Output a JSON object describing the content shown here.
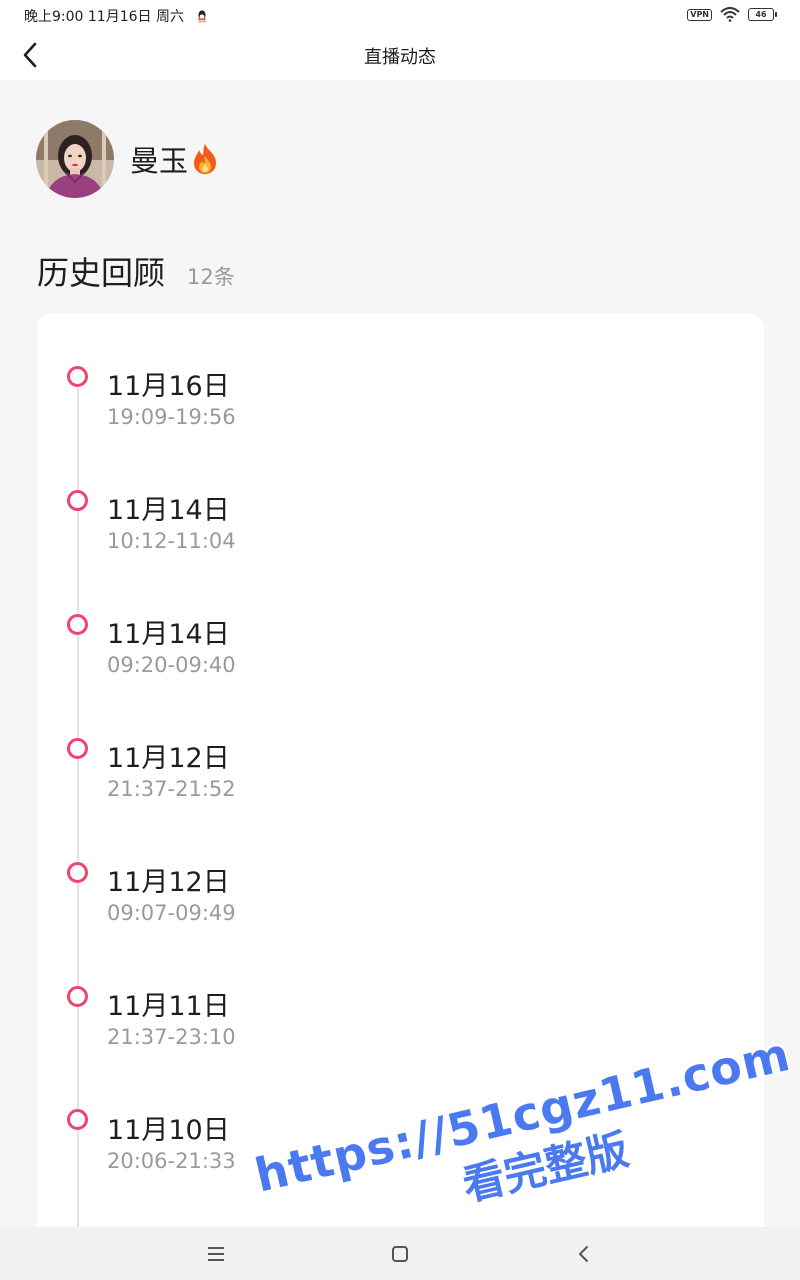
{
  "status_bar": {
    "time_text": "晚上9:00 11月16日 周六",
    "vpn": "VPN",
    "battery": "46",
    "icons": [
      "qq-icon",
      "wifi-icon",
      "battery-icon"
    ]
  },
  "header": {
    "title": "直播动态",
    "back_icon": "chevron-left-icon"
  },
  "profile": {
    "name": "曼玉",
    "badge_icon": "fire-icon"
  },
  "history": {
    "title": "历史回顾",
    "count": "12条",
    "accent_color": "#f0446d",
    "items": [
      {
        "date": "11月16日",
        "time": "19:09-19:56"
      },
      {
        "date": "11月14日",
        "time": "10:12-11:04"
      },
      {
        "date": "11月14日",
        "time": "09:20-09:40"
      },
      {
        "date": "11月12日",
        "time": "21:37-21:52"
      },
      {
        "date": "11月12日",
        "time": "09:07-09:49"
      },
      {
        "date": "11月11日",
        "time": "21:37-23:10"
      },
      {
        "date": "11月10日",
        "time": "20:06-21:33"
      }
    ]
  },
  "nav_bar": {
    "icons": [
      "menu-icon",
      "home-icon",
      "back-icon"
    ]
  },
  "watermark": {
    "url": "https://51cgz11.com",
    "text": "看完整版"
  }
}
